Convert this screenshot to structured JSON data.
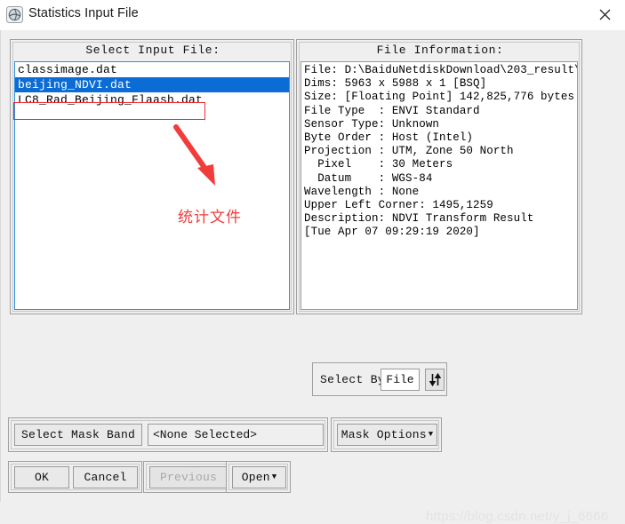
{
  "window": {
    "title": "Statistics Input File",
    "app_icon": "envi-globe-icon",
    "close_label": "✕"
  },
  "select_input": {
    "title": "Select Input File:",
    "files": [
      {
        "name": "classimage.dat",
        "selected": false
      },
      {
        "name": "beijing_NDVI.dat",
        "selected": true
      },
      {
        "name": "LC8_Rad_Beijing_Flaash.dat",
        "selected": false
      }
    ]
  },
  "file_information": {
    "title": "File Information:",
    "lines": [
      "File: D:\\BaiduNetdiskDownload\\203_result\\",
      "Dims: 5963 x 5988 x 1 [BSQ]",
      "Size: [Floating Point] 142,825,776 bytes.",
      "File Type  : ENVI Standard",
      "Sensor Type: Unknown",
      "Byte Order : Host (Intel)",
      "Projection : UTM, Zone 50 North",
      "  Pixel    : 30 Meters",
      "  Datum    : WGS-84",
      "Wavelength : None",
      "Upper Left Corner: 1495,1259",
      "Description: NDVI Transform Result",
      "[Tue Apr 07 09:29:19 2020]"
    ]
  },
  "select_by": {
    "label": "Select By",
    "value": "File",
    "toggle_icon": "up-down-arrows-icon"
  },
  "mask": {
    "select_band_label": "Select Mask Band",
    "band_value": "<None Selected>",
    "options_label": "Mask Options",
    "options_caret": "▼"
  },
  "buttons": {
    "ok": "OK",
    "cancel": "Cancel",
    "previous": "Previous",
    "open": "Open",
    "open_caret": "▼"
  },
  "annotation": {
    "text": "统计文件",
    "color": "#f23b3b"
  },
  "watermark": {
    "text": "https://blog.csdn.net/y_j_6666"
  },
  "colors": {
    "selection_blue": "#0a6cd4",
    "focus_border": "#2f8fe0",
    "dialog_background": "#efefef",
    "annotation_red": "#ef2b2b"
  }
}
